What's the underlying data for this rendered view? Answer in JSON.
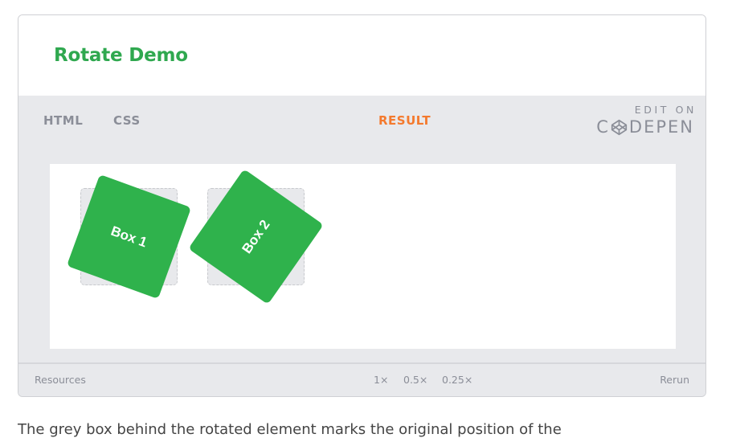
{
  "embed": {
    "title": "Rotate Demo",
    "tabs": [
      {
        "label": "HTML"
      },
      {
        "label": "CSS"
      },
      {
        "label": "RESULT",
        "active": true
      }
    ],
    "codepen": {
      "edit_on": "EDIT ON",
      "brand_c": "C",
      "brand_rest": "DEPEN",
      "icon": "codepen-logo-icon"
    },
    "result": {
      "boxes": [
        {
          "label": "Box 1",
          "rotation_deg": 20
        },
        {
          "label": "Box 2",
          "rotation_deg": -55
        }
      ]
    },
    "footer": {
      "resources": "Resources",
      "zooms": [
        "1×",
        "0.5×",
        "0.25×"
      ],
      "rerun": "Rerun"
    }
  },
  "colors": {
    "title_green": "#2fa84f",
    "box_green": "#2fb24c",
    "active_tab": "#f47a2e",
    "chrome_gray": "#e8e9ec",
    "muted_text": "#8b8e98"
  },
  "below_text": "The grey box behind the rotated element marks the original position of the"
}
